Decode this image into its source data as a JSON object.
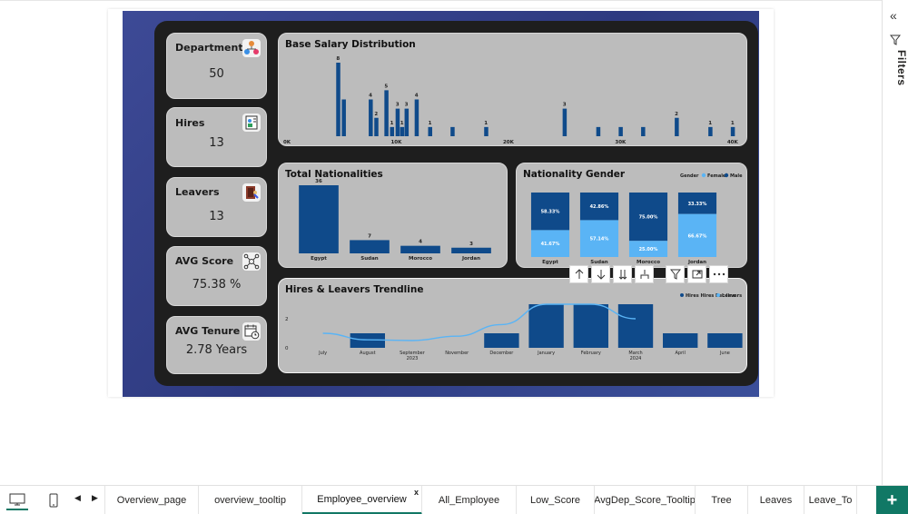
{
  "kpis": {
    "departments": {
      "title": "Departments",
      "value": "50",
      "icon": "org-chart-icon"
    },
    "hires": {
      "title": "Hires",
      "value": "13",
      "icon": "new-hire-icon"
    },
    "leavers": {
      "title": "Leavers",
      "value": "13",
      "icon": "exit-door-icon"
    },
    "avg_score": {
      "title": "AVG Score",
      "value": "75.38 %",
      "icon": "network-score-icon"
    },
    "avg_tenure": {
      "title": "AVG Tenure",
      "value": "2.78 Years",
      "icon": "calendar-clock-icon"
    }
  },
  "colors": {
    "bar_dark": "#0f4a8a",
    "bar_light": "#5ab4f5",
    "card_bg": "#bcbcbc",
    "accent": "#117865",
    "report_blue": "#3d4a96"
  },
  "salary_chart": {
    "title": "Base Salary Distribution",
    "x_tick_labels": [
      "0K",
      "10K",
      "20K",
      "30K",
      "40K"
    ]
  },
  "chart_data": [
    {
      "type": "bar",
      "name_key": "salary",
      "title": "Base Salary Distribution",
      "xlabel": "",
      "ylabel": "",
      "xlim": [
        0,
        40500
      ],
      "x": [
        4800,
        5300,
        7700,
        8200,
        9100,
        9600,
        10100,
        10500,
        10900,
        11800,
        13000,
        15000,
        18000,
        25000,
        28000,
        30000,
        32000,
        35000,
        38000,
        40000
      ],
      "values": [
        8,
        4,
        4,
        2,
        5,
        1,
        3,
        1,
        3,
        4,
        1,
        1,
        1,
        3,
        1,
        1,
        1,
        2,
        1,
        1
      ],
      "labeled_indices": [
        0,
        2,
        3,
        4,
        5,
        6,
        7,
        8,
        9,
        10,
        12,
        13,
        17,
        18,
        19
      ],
      "x_tick_labels": [
        "0K",
        "10K",
        "20K",
        "30K",
        "40K"
      ]
    },
    {
      "type": "bar",
      "title": "Total Nationalities",
      "categories": [
        "Egypt",
        "Sudan",
        "Morocco",
        "Jordan"
      ],
      "values": [
        36,
        7,
        4,
        3
      ],
      "ylim": [
        0,
        36
      ]
    },
    {
      "type": "bar",
      "title": "Nationality Gender",
      "stacked": "percent",
      "categories": [
        "Egypt",
        "Sudan",
        "Morocco",
        "Jordan"
      ],
      "legend_title": "Gender",
      "series": [
        {
          "name": "Female",
          "values": [
            41.67,
            57.14,
            25.0,
            66.67
          ],
          "labels": [
            "41.67%",
            "57.14%",
            "25.00%",
            "66.67%"
          ]
        },
        {
          "name": "Male",
          "values": [
            58.33,
            42.86,
            75.0,
            33.33
          ],
          "labels": [
            "58.33%",
            "42.86%",
            "75.00%",
            "33.33%"
          ]
        }
      ],
      "legend_placement": "top-right"
    },
    {
      "type": "bar",
      "title": "Hires & Leavers Trendline",
      "categories": [
        "July",
        "August",
        "September",
        "November",
        "December",
        "January",
        "February",
        "March",
        "April",
        "June"
      ],
      "year_labels": [
        {
          "label": "2023",
          "under": "September"
        },
        {
          "label": "2024",
          "under": "March"
        }
      ],
      "ylim": [
        0,
        3
      ],
      "y_ticks": [
        "0",
        "2"
      ],
      "series": [
        {
          "name": "Hires",
          "kind": "bar",
          "values": [
            0,
            1,
            0,
            0,
            1,
            3,
            3,
            3,
            1,
            1
          ]
        },
        {
          "name": "Hires Rec line",
          "kind": "line",
          "values": [
            1,
            0.55,
            0.5,
            0.8,
            1.6,
            3,
            3,
            2
          ]
        },
        {
          "name": "Leavers",
          "kind": "bar",
          "values": [
            0,
            0,
            0,
            0,
            0,
            0,
            0,
            0,
            0,
            0
          ]
        }
      ],
      "legend_placement": "top-right"
    }
  ],
  "filters_pane": {
    "label": "Filters"
  },
  "toolbar": {
    "icons": [
      "arrow-up-icon",
      "arrow-down-icon",
      "double-arrow-down-icon",
      "expand-hierarchy-icon",
      "filter-icon",
      "focus-mode-icon",
      "more-options-icon"
    ]
  },
  "tabs": [
    {
      "label": "Overview_page"
    },
    {
      "label": "overview_tooltip"
    },
    {
      "label": "Employee_overview",
      "active": true,
      "close": "x"
    },
    {
      "label": "All_Employee"
    },
    {
      "label": "Low_Score"
    },
    {
      "label": "AvgDep_Score_Tooltip"
    },
    {
      "label": "Tree"
    },
    {
      "label": "Leaves"
    },
    {
      "label": "Leave_To"
    }
  ],
  "add_page": "+"
}
